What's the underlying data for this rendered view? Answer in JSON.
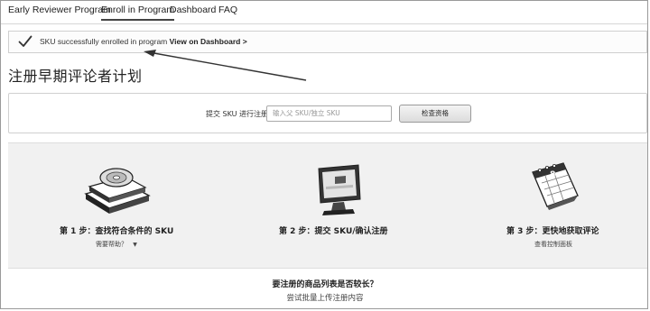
{
  "nav": {
    "tabs": [
      {
        "label": "Early Reviewer Program"
      },
      {
        "label": "Enroll in Program"
      },
      {
        "label": "Dashboard"
      },
      {
        "label": "FAQ"
      }
    ],
    "active_index": 1
  },
  "banner": {
    "message": "SKU successfully enrolled in program",
    "link_label": "View on Dashboard >",
    "icon": "check-icon"
  },
  "page": {
    "title": "注册早期评论者计划"
  },
  "submit": {
    "label": "提交 SKU 进行注册",
    "input_placeholder": "输入父 SKU/独立 SKU",
    "button_label": "检查资格"
  },
  "steps": [
    {
      "title": "第 1 步：查找符合条件的 SKU",
      "link": "需要帮助？",
      "icon": "books-disc-icon"
    },
    {
      "title": "第 2 步：提交 SKU/确认注册",
      "link": "",
      "icon": "monitor-icon"
    },
    {
      "title": "第 3 步：更快地获取评论",
      "link": "查看控制面板",
      "icon": "calendar-icon"
    }
  ],
  "bottom": {
    "question": "要注册的商品列表是否较长？",
    "link": "尝试批量上传注册内容"
  },
  "colors": {
    "banner_border": "#cfcfcf",
    "steps_bg": "#f1f1f1",
    "text": "#222222"
  }
}
